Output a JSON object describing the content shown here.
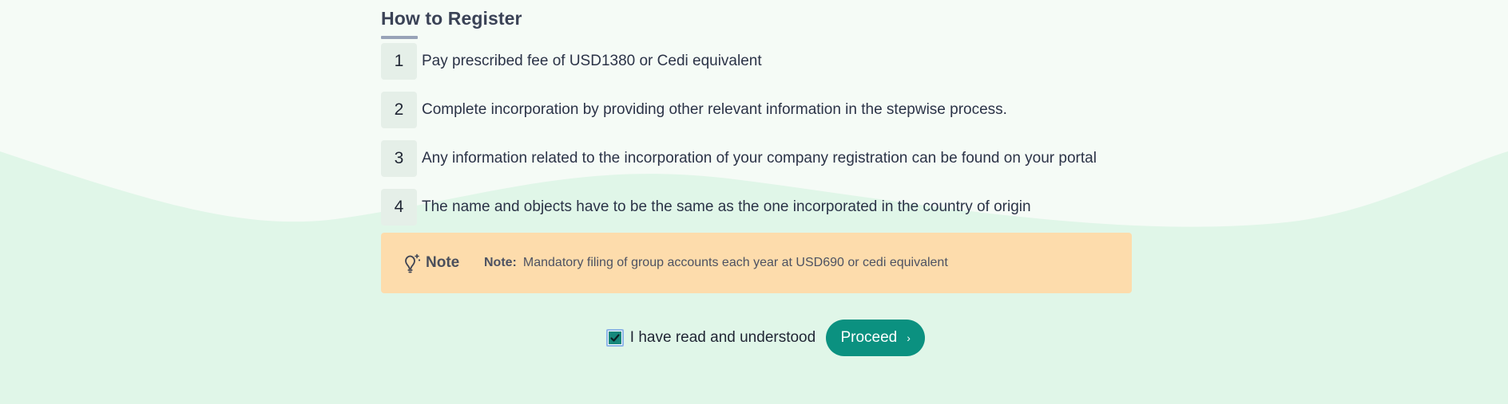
{
  "colors": {
    "page_bg": "#f5fbf6",
    "wave": "#e0f6e8",
    "step_badge": "#e5efe8",
    "note_bg": "#fddcac",
    "accent": "#0b9180",
    "checkbox_fill": "#16877b"
  },
  "section": {
    "title": "How to Register"
  },
  "steps": [
    {
      "number": "1",
      "text": "Pay prescribed fee of USD1380 or Cedi equivalent"
    },
    {
      "number": "2",
      "text": "Complete incorporation by providing other relevant information in the stepwise process."
    },
    {
      "number": "3",
      "text": "Any information related to the incorporation of your company registration can be found on your portal"
    },
    {
      "number": "4",
      "text": "The name and objects have to be the same as the one incorporated in the country of origin"
    }
  ],
  "note": {
    "icon": "lightbulb-icon",
    "heading": "Note",
    "label": "Note:",
    "text": "Mandatory filing of group accounts each year at USD690 or cedi equivalent"
  },
  "agreement": {
    "checked": true,
    "label": "I have read and understood"
  },
  "proceed": {
    "label": "Proceed",
    "icon": "chevron-right-icon"
  }
}
